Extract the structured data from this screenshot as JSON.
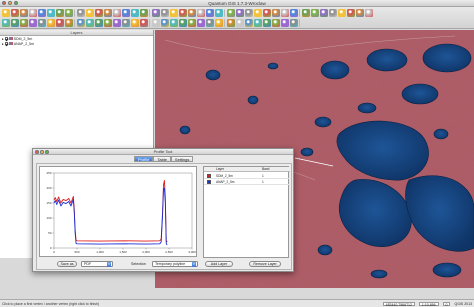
{
  "window": {
    "title": "Quantum GIS 1.7.3-Wroclaw"
  },
  "colors": {
    "water": "#15417a",
    "tundra": "#b2575f",
    "series1": "#e21a1a",
    "series2": "#1a2ed8"
  },
  "layers_panel": {
    "title": "Layers",
    "items": [
      {
        "label": "SDM_2_5m",
        "icon": "raster-layer-icon"
      },
      {
        "label": "ANAP_2_5m",
        "icon": "raster-layer-icon"
      }
    ]
  },
  "profile_dialog": {
    "title": "Profile Tool",
    "tabs": [
      {
        "label": "Profile"
      },
      {
        "label": "Table"
      },
      {
        "label": "Settings"
      }
    ],
    "layer_table": {
      "headers": [
        "",
        "Layer",
        "Band"
      ],
      "rows": [
        {
          "color": "#e21a1a",
          "layer": "SDM_2_5m",
          "band": "1"
        },
        {
          "color": "#1a2ed8",
          "layer": "ANAP_2_5m",
          "band": "1"
        }
      ]
    },
    "save_button": "Save as",
    "format_value": "PDF",
    "selection_label": "Selection",
    "selection_value": "Temporary polyline",
    "add_layer_button": "Add Layer",
    "remove_layer_button": "Remove Layer"
  },
  "chart_data": {
    "type": "line",
    "title": "",
    "xlabel": "",
    "ylabel": "",
    "xlim": [
      0,
      3000
    ],
    "ylim": [
      0,
      250
    ],
    "xticks": [
      "0",
      "500",
      "1,000",
      "1,500",
      "2,000",
      "2,500",
      "3,000"
    ],
    "yticks": [
      "0",
      "50",
      "100",
      "150",
      "200",
      "250"
    ],
    "series": [
      {
        "name": "SDM_2_5m",
        "color": "#e21a1a",
        "x": [
          0,
          30,
          60,
          100,
          150,
          200,
          260,
          320,
          370,
          420,
          440,
          460,
          480,
          500,
          1000,
          1500,
          2000,
          2300,
          2330,
          2360,
          2380,
          2400,
          2420,
          2440,
          2460
        ],
        "y": [
          160,
          168,
          155,
          170,
          150,
          162,
          158,
          165,
          150,
          172,
          130,
          60,
          25,
          24,
          23,
          24,
          23,
          24,
          30,
          120,
          210,
          225,
          170,
          25,
          20
        ]
      },
      {
        "name": "ANAP_2_5m",
        "color": "#1a2ed8",
        "x": [
          0,
          30,
          60,
          100,
          150,
          200,
          260,
          320,
          370,
          420,
          440,
          460,
          480,
          500,
          1000,
          1500,
          2000,
          2300,
          2330,
          2360,
          2380,
          2400,
          2420,
          2440,
          2460
        ],
        "y": [
          150,
          158,
          145,
          160,
          140,
          152,
          148,
          155,
          140,
          162,
          120,
          50,
          15,
          14,
          13,
          14,
          13,
          14,
          20,
          110,
          195,
          200,
          150,
          15,
          10
        ]
      }
    ]
  },
  "status_bar": {
    "left_text": "Click to place a first vertex / another vertex (right click to finish)",
    "coordinate": "483440,7566712",
    "scale": "1:10,656",
    "rotation": "0",
    "right_text": "QGIS 2013"
  }
}
